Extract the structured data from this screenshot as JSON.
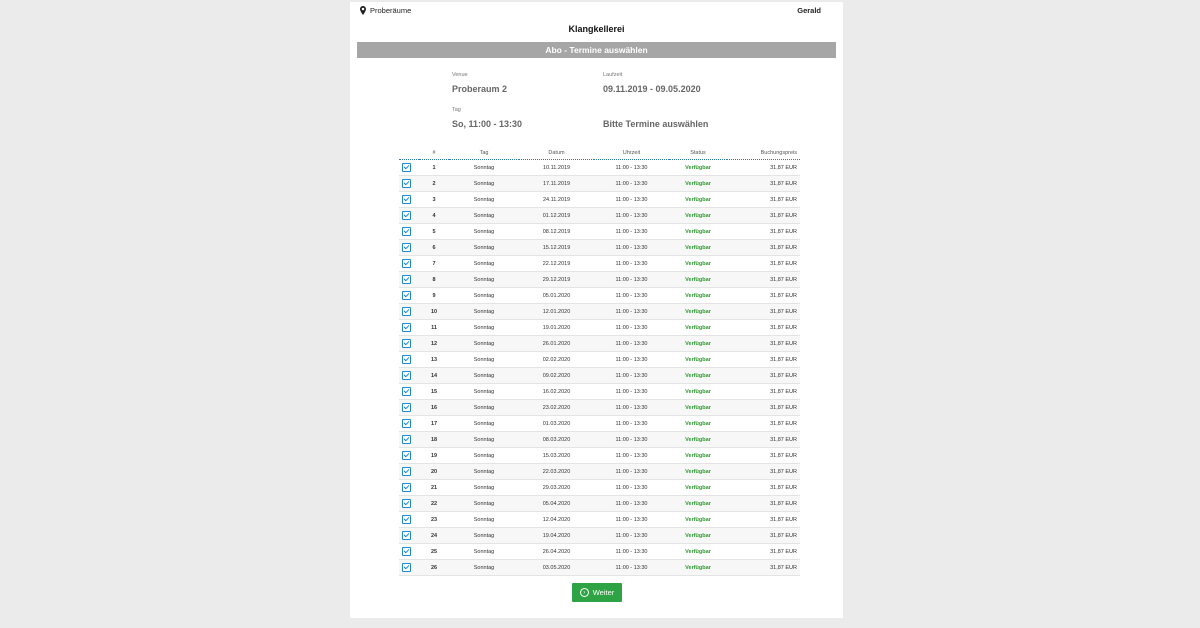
{
  "header": {
    "location_label": "Proberäume",
    "user_name": "Gerald",
    "venue_name": "Klangkellerei",
    "banner": "Abo - Termine auswählen"
  },
  "info": {
    "venue_label": "Venue",
    "venue_value": "Proberaum 2",
    "period_label": "Laufzeit",
    "period_value": "09.11.2019 - 09.05.2020",
    "day_label": "Tag",
    "day_value": "So, 11:00 - 13:30",
    "hint": "Bitte Termine auswählen"
  },
  "table": {
    "headers": [
      "#",
      "Tag",
      "Datum",
      "Uhrzeit",
      "Status",
      "Buchungspreis"
    ],
    "rows": [
      [
        "1",
        "Sonntag",
        "10.11.2019",
        "11:00 - 13:30",
        "Verfügbar",
        "31,87 EUR"
      ],
      [
        "2",
        "Sonntag",
        "17.11.2019",
        "11:00 - 13:30",
        "Verfügbar",
        "31,87 EUR"
      ],
      [
        "3",
        "Sonntag",
        "24.11.2019",
        "11:00 - 13:30",
        "Verfügbar",
        "31,87 EUR"
      ],
      [
        "4",
        "Sonntag",
        "01.12.2019",
        "11:00 - 13:30",
        "Verfügbar",
        "31,87 EUR"
      ],
      [
        "5",
        "Sonntag",
        "08.12.2019",
        "11:00 - 13:30",
        "Verfügbar",
        "31,87 EUR"
      ],
      [
        "6",
        "Sonntag",
        "15.12.2019",
        "11:00 - 13:30",
        "Verfügbar",
        "31,87 EUR"
      ],
      [
        "7",
        "Sonntag",
        "22.12.2019",
        "11:00 - 13:30",
        "Verfügbar",
        "31,87 EUR"
      ],
      [
        "8",
        "Sonntag",
        "29.12.2019",
        "11:00 - 13:30",
        "Verfügbar",
        "31,87 EUR"
      ],
      [
        "9",
        "Sonntag",
        "05.01.2020",
        "11:00 - 13:30",
        "Verfügbar",
        "31,87 EUR"
      ],
      [
        "10",
        "Sonntag",
        "12.01.2020",
        "11:00 - 13:30",
        "Verfügbar",
        "31,87 EUR"
      ],
      [
        "11",
        "Sonntag",
        "19.01.2020",
        "11:00 - 13:30",
        "Verfügbar",
        "31,87 EUR"
      ],
      [
        "12",
        "Sonntag",
        "26.01.2020",
        "11:00 - 13:30",
        "Verfügbar",
        "31,87 EUR"
      ],
      [
        "13",
        "Sonntag",
        "02.02.2020",
        "11:00 - 13:30",
        "Verfügbar",
        "31,87 EUR"
      ],
      [
        "14",
        "Sonntag",
        "09.02.2020",
        "11:00 - 13:30",
        "Verfügbar",
        "31,87 EUR"
      ],
      [
        "15",
        "Sonntag",
        "16.02.2020",
        "11:00 - 13:30",
        "Verfügbar",
        "31,87 EUR"
      ],
      [
        "16",
        "Sonntag",
        "23.02.2020",
        "11:00 - 13:30",
        "Verfügbar",
        "31,87 EUR"
      ],
      [
        "17",
        "Sonntag",
        "01.03.2020",
        "11:00 - 13:30",
        "Verfügbar",
        "31,87 EUR"
      ],
      [
        "18",
        "Sonntag",
        "08.03.2020",
        "11:00 - 13:30",
        "Verfügbar",
        "31,87 EUR"
      ],
      [
        "19",
        "Sonntag",
        "15.03.2020",
        "11:00 - 13:30",
        "Verfügbar",
        "31,87 EUR"
      ],
      [
        "20",
        "Sonntag",
        "22.03.2020",
        "11:00 - 13:30",
        "Verfügbar",
        "31,87 EUR"
      ],
      [
        "21",
        "Sonntag",
        "29.03.2020",
        "11:00 - 13:30",
        "Verfügbar",
        "31,87 EUR"
      ],
      [
        "22",
        "Sonntag",
        "05.04.2020",
        "11:00 - 13:30",
        "Verfügbar",
        "31,87 EUR"
      ],
      [
        "23",
        "Sonntag",
        "12.04.2020",
        "11:00 - 13:30",
        "Verfügbar",
        "31,87 EUR"
      ],
      [
        "24",
        "Sonntag",
        "19.04.2020",
        "11:00 - 13:30",
        "Verfügbar",
        "31,87 EUR"
      ],
      [
        "25",
        "Sonntag",
        "26.04.2020",
        "11:00 - 13:30",
        "Verfügbar",
        "31,87 EUR"
      ],
      [
        "26",
        "Sonntag",
        "03.05.2020",
        "11:00 - 13:30",
        "Verfügbar",
        "31,87 EUR"
      ]
    ]
  },
  "actions": {
    "next_label": "Weiter"
  },
  "colors": {
    "banner": "#a6a6a6",
    "status_available": "#2e9a2e",
    "checkbox": "#1f8ac9",
    "next_button": "#2ea344",
    "page_background": "#ebebeb"
  },
  "icons": {
    "location": "map-pin-icon",
    "checkbox": "checkbox-checked-icon",
    "next": "circle-arrow-icon"
  }
}
